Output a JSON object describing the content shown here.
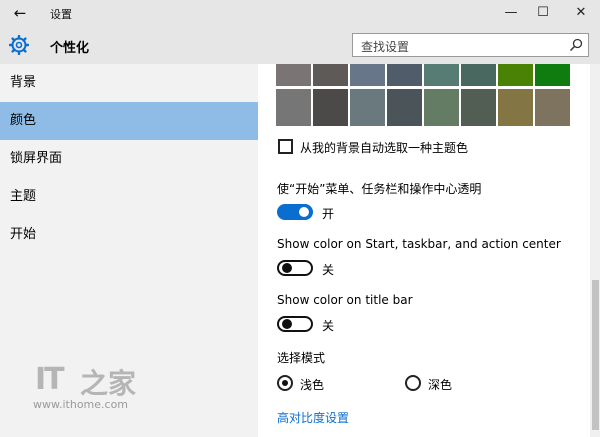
{
  "titlebar": {
    "back_icon": "←",
    "title": "设置",
    "minimize_icon": "—",
    "maximize_icon": "☐",
    "close_icon": "✕"
  },
  "header": {
    "icon": "gear-icon",
    "title": "个性化"
  },
  "search": {
    "placeholder": "查找设置",
    "icon": "search-icon"
  },
  "sidebar": {
    "items": [
      {
        "label": "背景"
      },
      {
        "label": "颜色"
      },
      {
        "label": "锁屏界面"
      },
      {
        "label": "主题"
      },
      {
        "label": "开始"
      }
    ],
    "selected_index": 1,
    "selected_color": "#8fbce6"
  },
  "colors": {
    "palette": [
      [
        "#7a7474",
        "#5d5a58",
        "#68768a",
        "#515c6b",
        "#567c73",
        "#486860",
        "#498205",
        "#107c10"
      ],
      [
        "#767676",
        "#4c4a48",
        "#69797e",
        "#4a5459",
        "#647c64",
        "#525e54",
        "#847545",
        "#7e735f"
      ]
    ],
    "auto_pick_label": "从我的背景自动选取一种主题色",
    "auto_pick_checked": false
  },
  "transparency": {
    "label": "使“开始”菜单、任务栏和操作中心透明",
    "state": "开",
    "on": true
  },
  "show_color_start": {
    "label": "Show color on Start, taskbar, and action center",
    "state": "关",
    "on": false
  },
  "show_color_title": {
    "label": "Show color on title bar",
    "state": "关",
    "on": false
  },
  "mode": {
    "label": "选择模式",
    "options": [
      {
        "label": "浅色",
        "selected": true
      },
      {
        "label": "深色",
        "selected": false
      }
    ]
  },
  "high_contrast_link": "高对比度设置",
  "accent_color": "#0a6ed1",
  "watermark": {
    "logo_text": "IT",
    "logo_glyph": "之家",
    "url": "www.ithome.com"
  }
}
